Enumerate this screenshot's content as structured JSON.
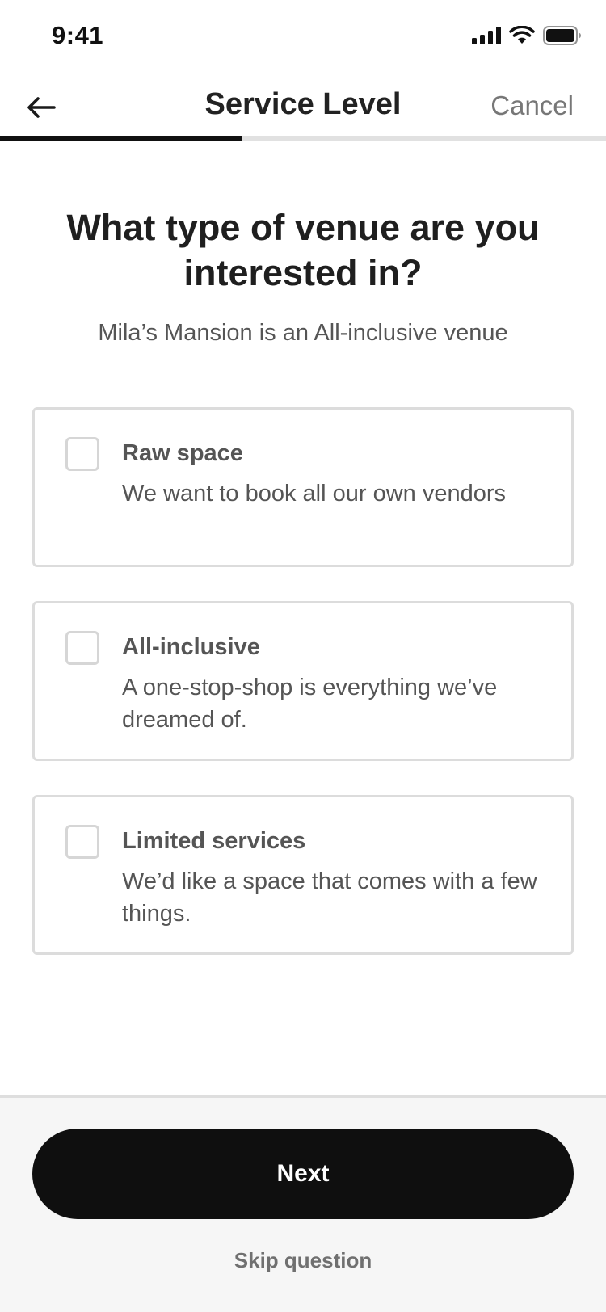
{
  "status_bar": {
    "time": "9:41",
    "icons": [
      "cellular-signal-icon",
      "wifi-icon",
      "battery-icon"
    ]
  },
  "nav": {
    "back_icon": "arrow-left-icon",
    "title": "Service Level",
    "cancel_label": "Cancel",
    "progress_fraction": 0.4
  },
  "question": {
    "title": "What type of venue are you interested in?",
    "subtitle": "Mila’s Mansion is an All-inclusive venue"
  },
  "options": [
    {
      "title": "Raw space",
      "description": "We want to book all our own vendors",
      "checked": false
    },
    {
      "title": "All-inclusive",
      "description": "A one-stop-shop is everything we’ve dreamed of.",
      "checked": false
    },
    {
      "title": "Limited services",
      "description": "We’d like a space that comes with a few things.",
      "checked": false
    }
  ],
  "footer": {
    "next_label": "Next",
    "skip_label": "Skip question"
  },
  "colors": {
    "primary": "#0f0f0f",
    "border": "#dcdcdc",
    "muted_text": "#555555",
    "footer_bg": "#f6f6f6"
  }
}
